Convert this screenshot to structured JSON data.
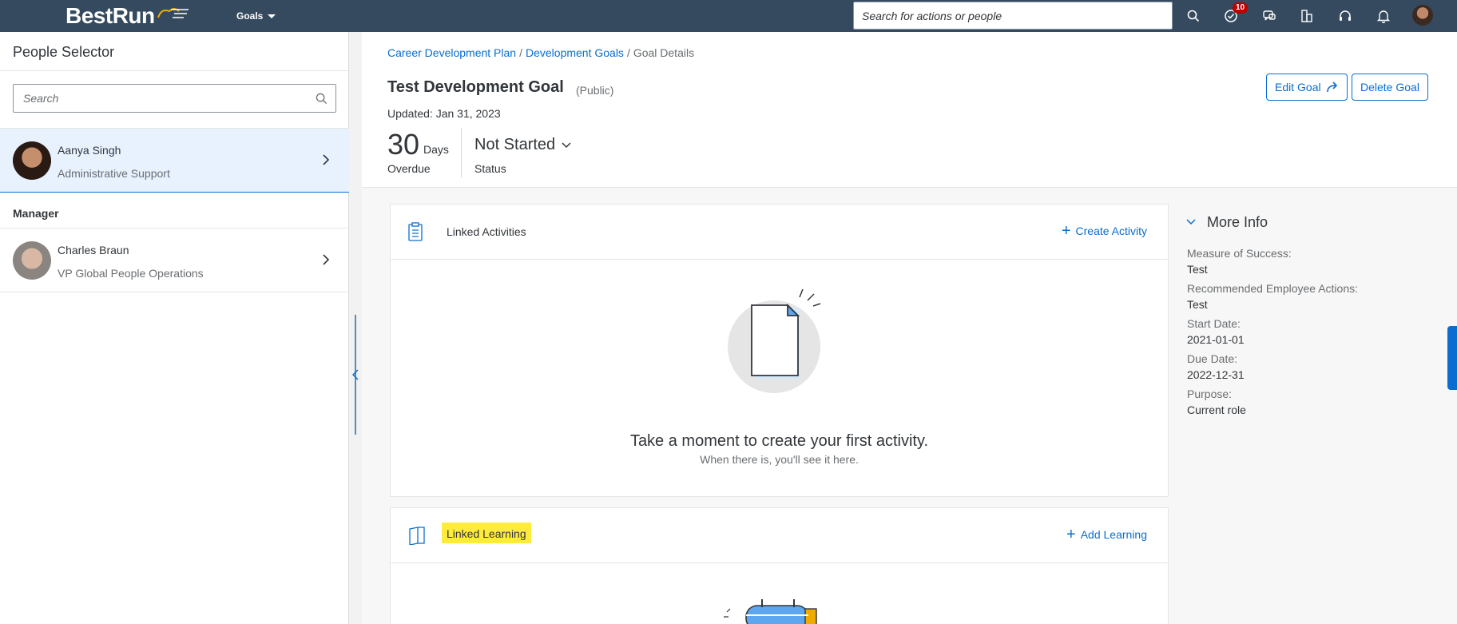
{
  "shellbar": {
    "logo_best": "Best",
    "logo_run": "Run",
    "menu_label": "Goals",
    "search_placeholder": "Search for actions or people",
    "notifications_badge": "10",
    "icons": [
      "search-icon",
      "todo-check-icon",
      "chat-icon",
      "org-chart-icon",
      "headset-icon",
      "bell-icon",
      "user-avatar"
    ]
  },
  "people_selector": {
    "title": "People Selector",
    "search_placeholder": "Search",
    "selected_person": {
      "name": "Aanya Singh",
      "role": "Administrative Support"
    },
    "manager_label": "Manager",
    "manager": {
      "name": "Charles Braun",
      "role": "VP Global People Operations"
    }
  },
  "breadcrumb": {
    "items": [
      "Career Development Plan",
      "Development Goals"
    ],
    "current": "Goal Details",
    "separator": "/"
  },
  "goal": {
    "title": "Test Development Goal",
    "visibility": "(Public)",
    "updated": "Updated: Jan 31, 2023",
    "overdue_number": "30",
    "overdue_unit": "Days",
    "overdue_label": "Overdue",
    "status_value": "Not Started",
    "status_label": "Status",
    "edit_button": "Edit Goal",
    "delete_button": "Delete Goal"
  },
  "linked_activities": {
    "title": "Linked Activities",
    "action": "Create Activity",
    "empty_title": "Take a moment to create your first activity.",
    "empty_sub": "When there is, you'll see it here."
  },
  "linked_learning": {
    "title": "Linked Learning",
    "action": "Add Learning"
  },
  "more_info": {
    "title": "More Info",
    "fields": [
      {
        "label": "Measure of Success:",
        "value": "Test"
      },
      {
        "label": "Recommended Employee Actions:",
        "value": "Test"
      },
      {
        "label": "Start Date:",
        "value": "2021-01-01"
      },
      {
        "label": "Due Date:",
        "value": "2022-12-31"
      },
      {
        "label": "Purpose:",
        "value": "Current role"
      }
    ]
  },
  "colors": {
    "shell": "#354a5f",
    "accent": "#0a6ed1",
    "highlight": "#ffeb3b",
    "badge": "#bb0000"
  }
}
